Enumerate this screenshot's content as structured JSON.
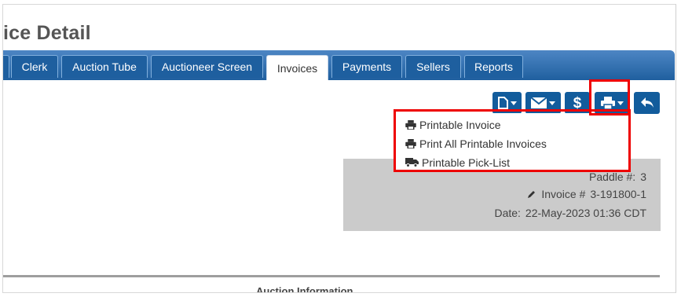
{
  "page": {
    "title": "ice Detail"
  },
  "tabs": [
    {
      "label": "Clerk"
    },
    {
      "label": "Auction Tube"
    },
    {
      "label": "Auctioneer Screen"
    },
    {
      "label": "Invoices",
      "active": true
    },
    {
      "label": "Payments"
    },
    {
      "label": "Sellers"
    },
    {
      "label": "Reports"
    }
  ],
  "toolbar": {
    "buttons": [
      "new-document-icon",
      "email-icon",
      "dollar-icon",
      "print-icon",
      "back-arrow-icon"
    ],
    "dollar_label": "$"
  },
  "print_menu": {
    "items": [
      {
        "label": "Printable Invoice",
        "icon": "print-icon"
      },
      {
        "label": "Print All Printable Invoices",
        "icon": "print-icon"
      },
      {
        "label": "Printable Pick-List",
        "icon": "truck-icon"
      }
    ]
  },
  "invoice_info": {
    "paddle_label": "Paddle #:",
    "paddle_value": "3",
    "invoice_label": "Invoice #",
    "invoice_value": "3-191800-1",
    "date_label": "Date:",
    "date_value": "22-May-2023 01:36 CDT"
  },
  "section": {
    "title": "Auction Information"
  },
  "colors": {
    "tab_bar": "#1f5f9f",
    "button": "#125c9c",
    "highlight": "#e00000",
    "info_bg": "#cbcbcb"
  }
}
